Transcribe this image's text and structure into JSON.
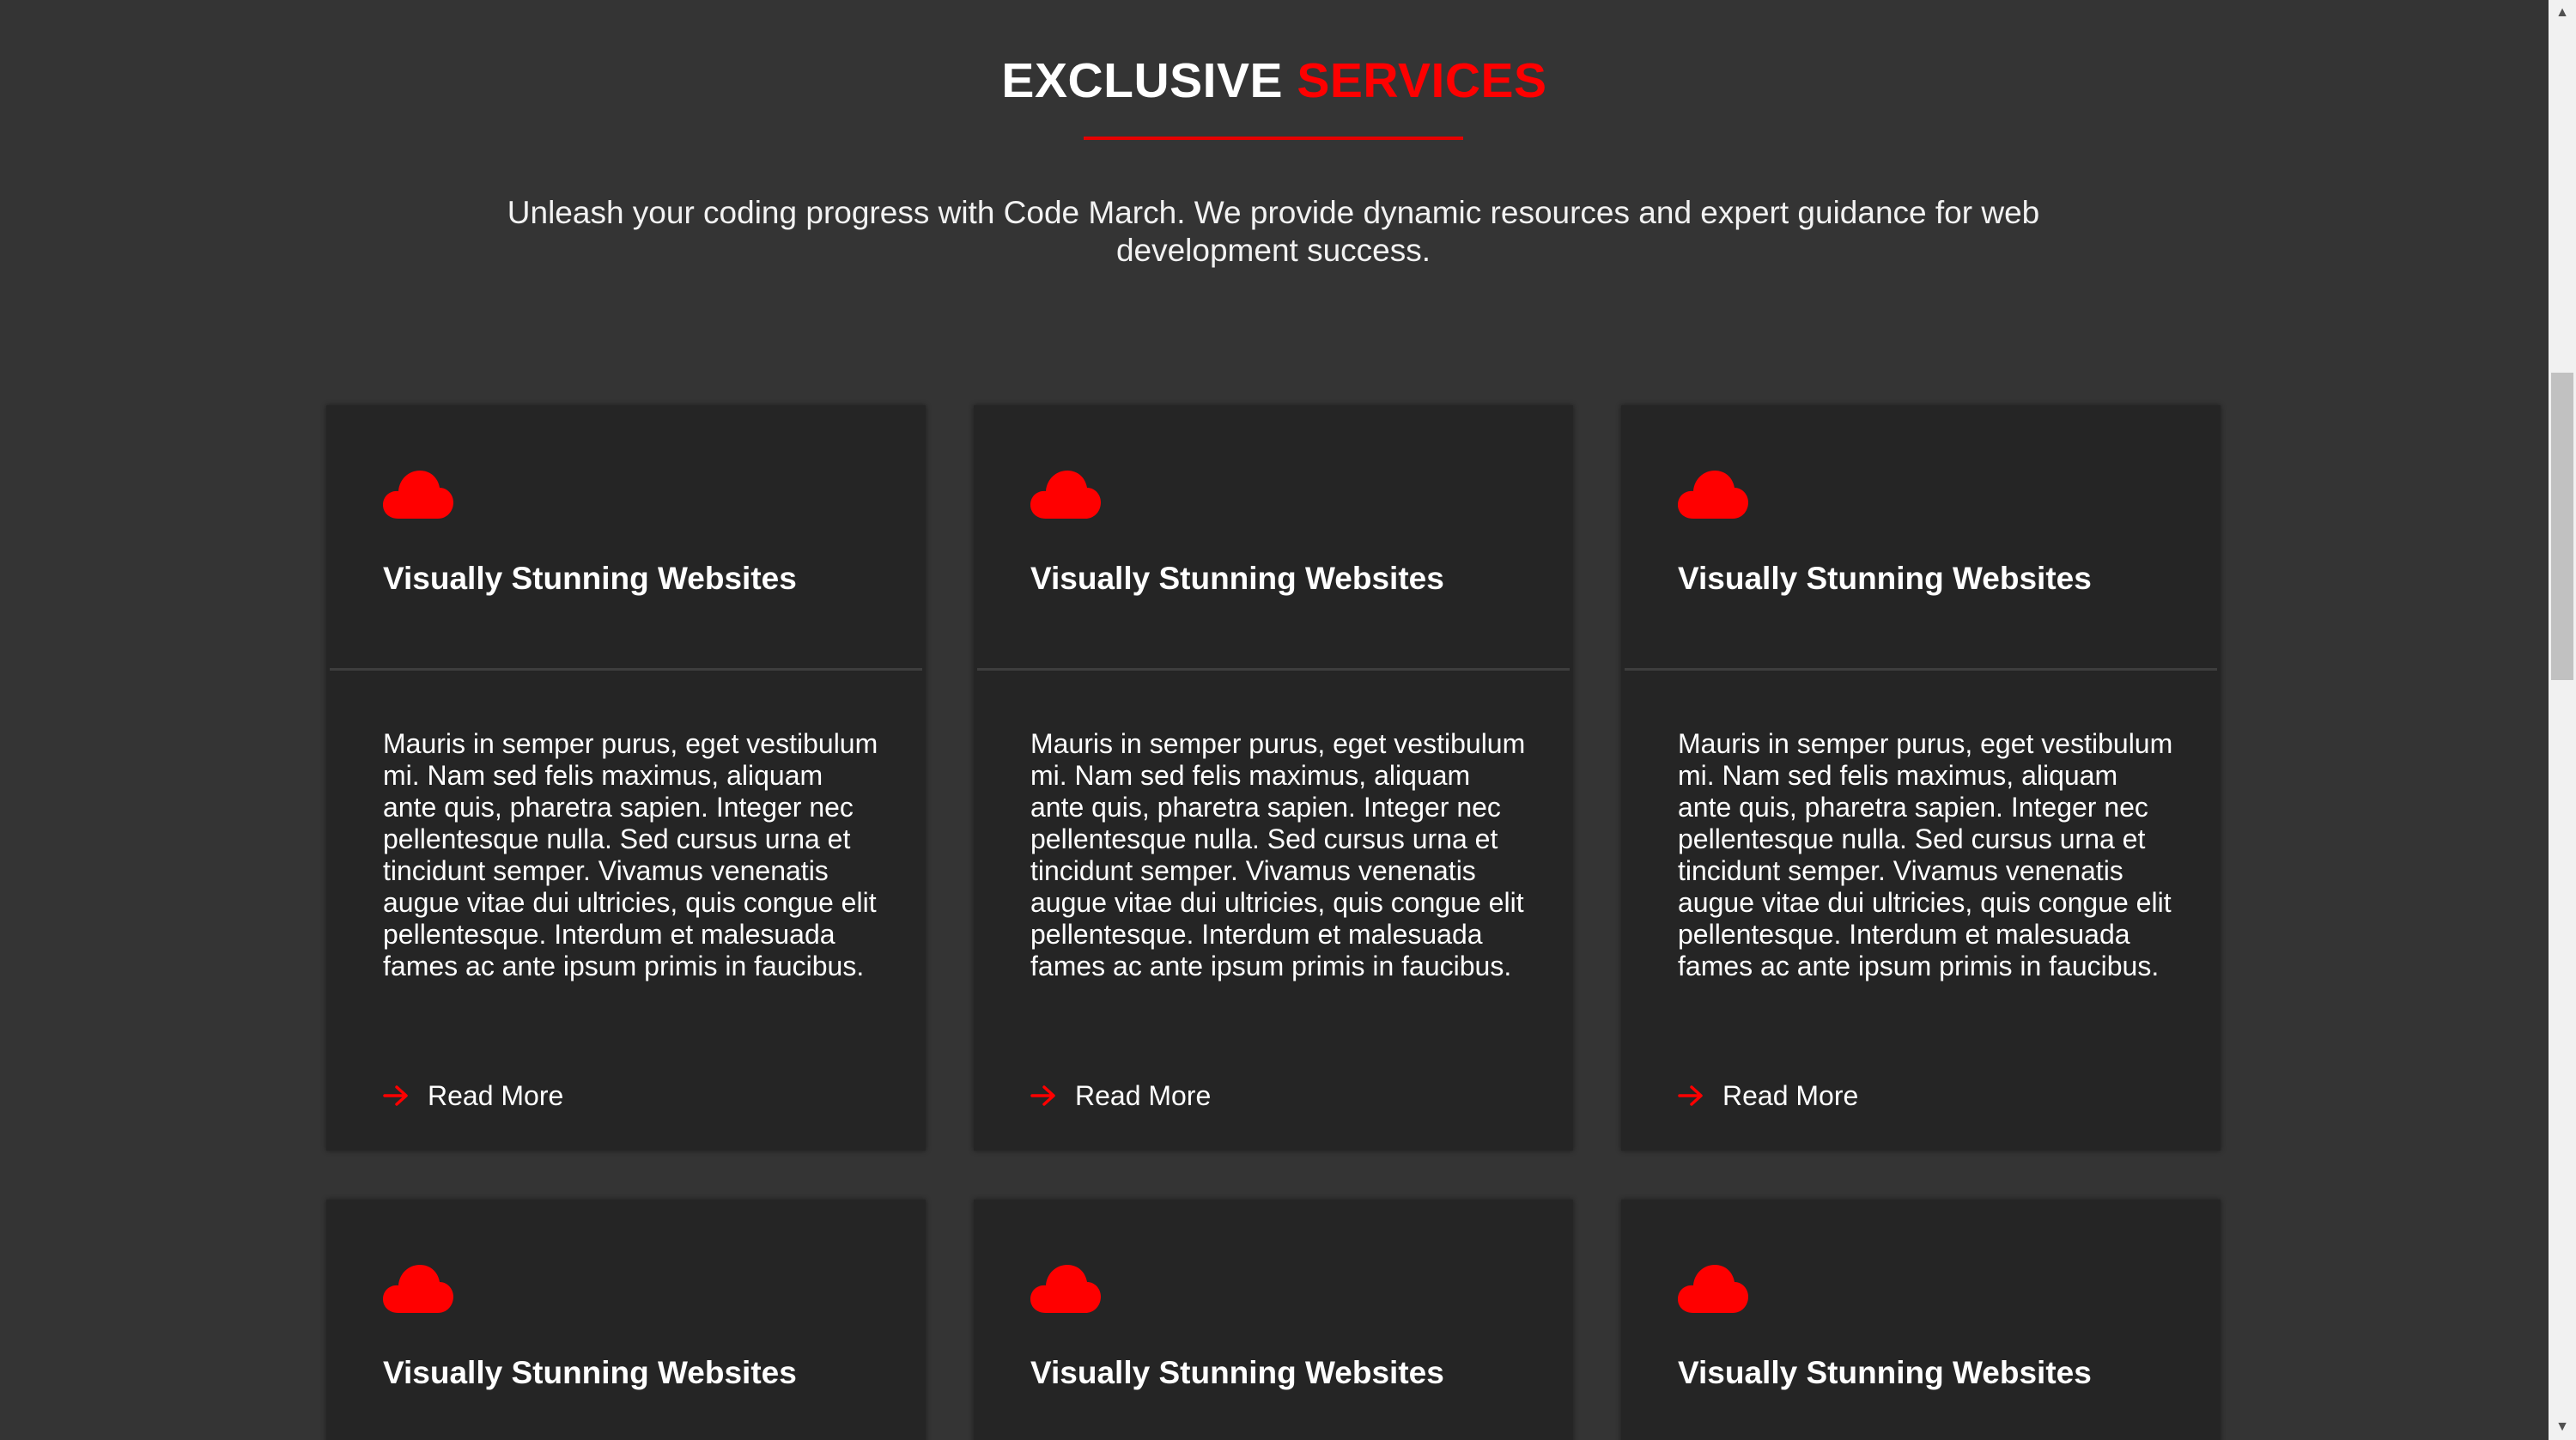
{
  "section": {
    "title_main": "EXCLUSIVE ",
    "title_accent": "SERVICES",
    "intro": "Unleash your coding progress with Code March. We provide dynamic resources and expert guidance for web development success."
  },
  "colors": {
    "accent": "#ff0000",
    "background": "#343434",
    "card": "#252525",
    "text": "#ffffff"
  },
  "cards": [
    {
      "icon": "cloud-icon",
      "title": "Visually Stunning Websites",
      "text": "Mauris in semper purus, eget vestibulum mi. Nam sed felis maximus, aliquam ante quis, pharetra sapien. Integer nec pellentesque nulla. Sed cursus urna et tincidunt semper. Vivamus venenatis augue vitae dui ultricies, quis congue elit pellentesque. Interdum et malesuada fames ac ante ipsum primis in faucibus.",
      "link": "Read More"
    },
    {
      "icon": "cloud-icon",
      "title": "Visually Stunning Websites",
      "text": "Mauris in semper purus, eget vestibulum mi. Nam sed felis maximus, aliquam ante quis, pharetra sapien. Integer nec pellentesque nulla. Sed cursus urna et tincidunt semper. Vivamus venenatis augue vitae dui ultricies, quis congue elit pellentesque. Interdum et malesuada fames ac ante ipsum primis in faucibus.",
      "link": "Read More"
    },
    {
      "icon": "cloud-icon",
      "title": "Visually Stunning Websites",
      "text": "Mauris in semper purus, eget vestibulum mi. Nam sed felis maximus, aliquam ante quis, pharetra sapien. Integer nec pellentesque nulla. Sed cursus urna et tincidunt semper. Vivamus venenatis augue vitae dui ultricies, quis congue elit pellentesque. Interdum et malesuada fames ac ante ipsum primis in faucibus.",
      "link": "Read More"
    },
    {
      "icon": "cloud-icon",
      "title": "Visually Stunning Websites"
    },
    {
      "icon": "cloud-icon",
      "title": "Visually Stunning Websites"
    },
    {
      "icon": "cloud-icon",
      "title": "Visually Stunning Websites"
    }
  ]
}
